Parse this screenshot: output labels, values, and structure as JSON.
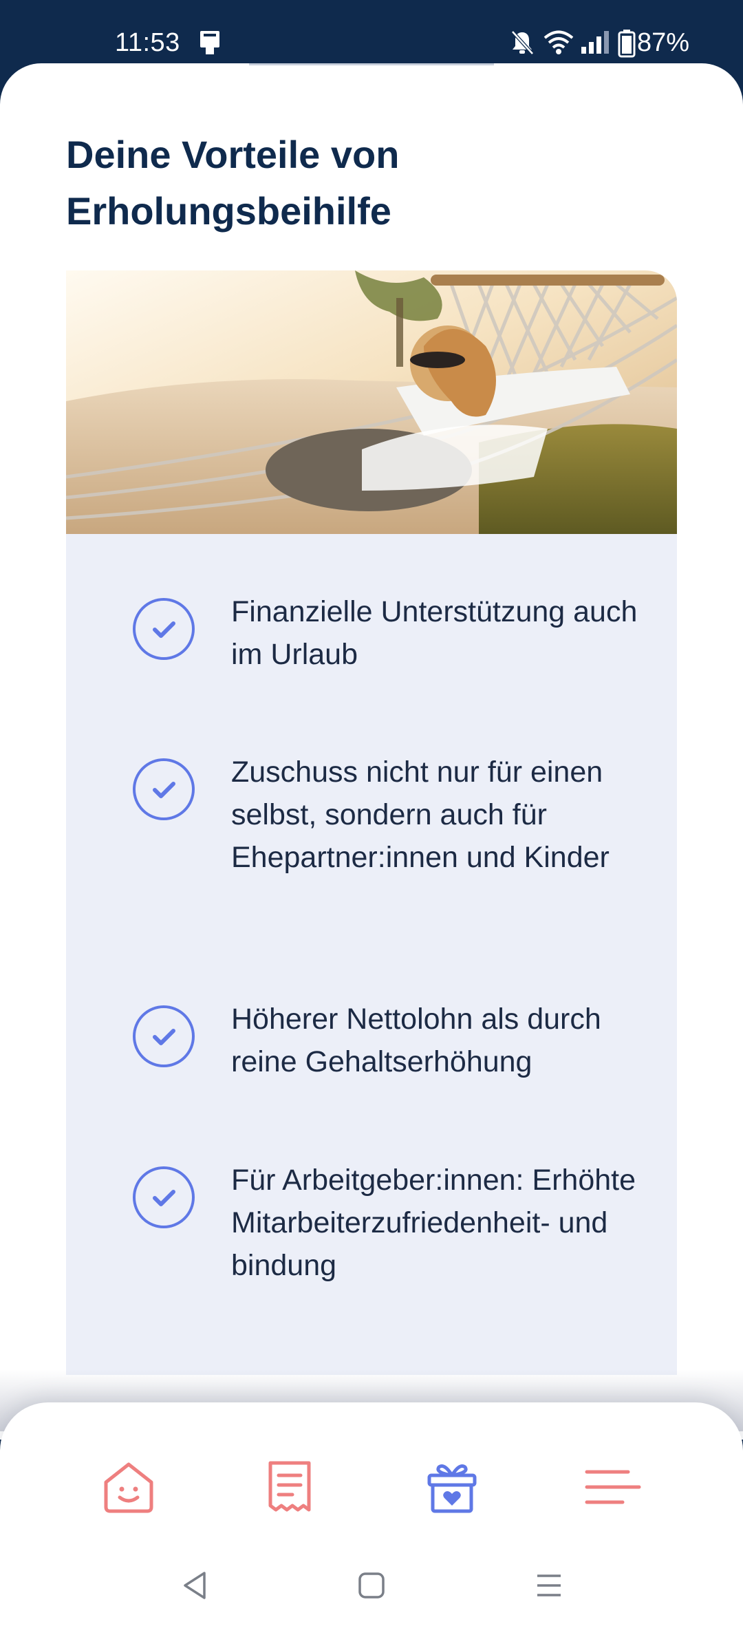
{
  "status_bar": {
    "time": "11:53",
    "battery_percent": "87%"
  },
  "page": {
    "title": "Deine Vorteile von Erholungsbeihilfe",
    "hero_image": "woman-relaxing-in-hammock-at-beach"
  },
  "benefits": [
    {
      "text": "Finanzielle Unterstützung auch im Urlaub"
    },
    {
      "text": "Zuschuss nicht nur für einen selbst, sondern auch für Ehepartner:innen und Kinder"
    },
    {
      "text": "Höherer Nettolohn als durch reine Gehaltserhöhung"
    },
    {
      "text": "Für Arbeitgeber:innen: Erhöhte Mitarbeiterzufriedenheit- und bindung"
    }
  ],
  "bottom_nav": {
    "items": [
      {
        "icon": "home-smile-icon",
        "active": false
      },
      {
        "icon": "receipt-icon",
        "active": false
      },
      {
        "icon": "gift-heart-icon",
        "active": true
      },
      {
        "icon": "menu-icon",
        "active": false
      }
    ]
  },
  "colors": {
    "header_bg": "#0f2a4d",
    "title": "#0f2a4d",
    "panel_bg": "#eceff8",
    "check_accent": "#5f78e6",
    "nav_inactive": "#ee7f7f",
    "nav_active": "#5f78e6"
  }
}
